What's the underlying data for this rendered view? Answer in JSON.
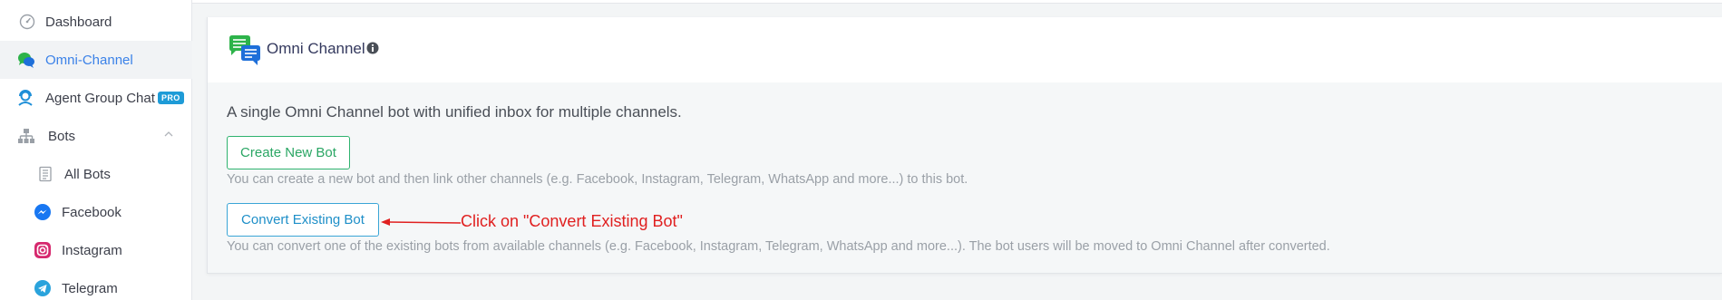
{
  "sidebar": {
    "items": [
      {
        "label": "Dashboard",
        "icon": "dashboard-gauge-icon"
      },
      {
        "label": "Omni-Channel",
        "icon": "omni-channel-chat-icon",
        "active": true
      },
      {
        "label": "Agent Group Chat",
        "icon": "agent-headset-icon",
        "badge": "PRO"
      },
      {
        "label": "Bots",
        "icon": "bots-sitemap-icon",
        "expanded": true
      },
      {
        "label": "All Bots",
        "icon": "list-document-icon"
      },
      {
        "label": "Facebook",
        "icon": "facebook-messenger-icon"
      },
      {
        "label": "Instagram",
        "icon": "instagram-icon"
      },
      {
        "label": "Telegram",
        "icon": "telegram-icon"
      }
    ]
  },
  "card": {
    "title": "Omni Channel",
    "description": "A single Omni Channel bot with unified inbox for multiple channels.",
    "create_button": "Create New Bot",
    "create_hint": "You can create a new bot and then link other channels (e.g. Facebook, Instagram, Telegram, WhatsApp and more...) to this bot.",
    "convert_button": "Convert Existing Bot",
    "convert_hint": "You can convert one of the existing bots from available channels (e.g. Facebook, Instagram, Telegram, WhatsApp and more...). The bot users will be moved to Omni Channel after converted."
  },
  "annotation": {
    "text": "Click on \"Convert Existing Bot\""
  },
  "colors": {
    "active_nav": "#3b82e8",
    "create_button": "#2aa664",
    "convert_button": "#1e8fc8",
    "annotation": "#e02020",
    "pro_badge": "#1e9bd7"
  }
}
